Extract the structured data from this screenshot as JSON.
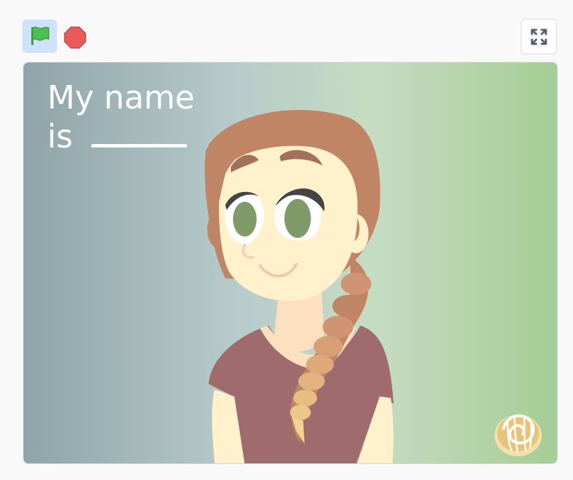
{
  "toolbar": {
    "green_flag": {
      "icon": "green-flag-icon",
      "color": "#4cbf56"
    },
    "stop": {
      "icon": "stop-sign-icon",
      "color": "#ec5959"
    },
    "fullscreen": {
      "icon": "fullscreen-icon"
    }
  },
  "stage": {
    "title_line1": "My name",
    "title_line2": "is",
    "background_gradient": [
      "#8ea4a8",
      "#b7cbca",
      "#c6dcc2",
      "#a4cd94"
    ],
    "sprites": [
      {
        "name": "girl-character",
        "icon": "girl-with-braid"
      },
      {
        "name": "cinnamon-bun",
        "icon": "cinnamon-roll-icon"
      }
    ]
  }
}
